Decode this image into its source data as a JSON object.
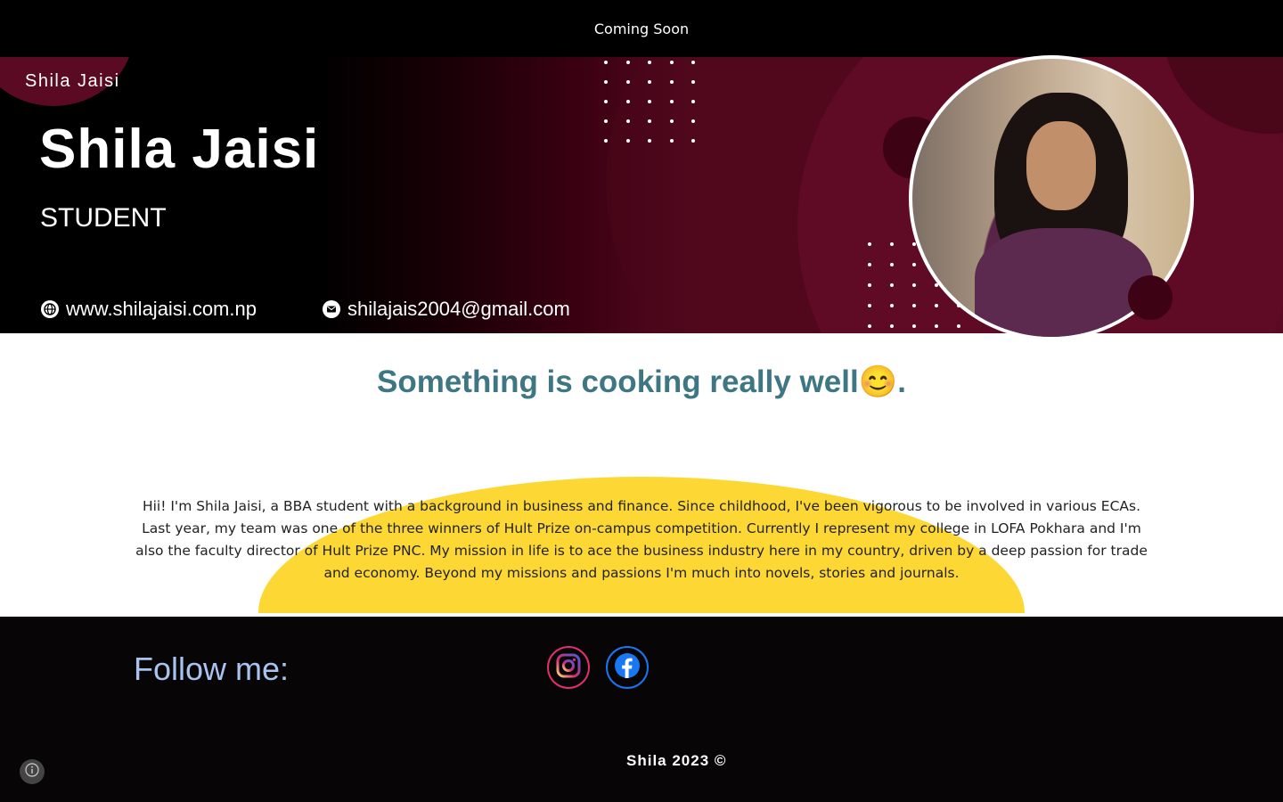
{
  "header": {
    "title": "Coming Soon"
  },
  "banner": {
    "site_name": "Shila Jaisi",
    "name": "Shila Jaisi",
    "role": "STUDENT",
    "website": "www.shilajaisi.com.np",
    "email": "shilajais2004@gmail.com"
  },
  "main": {
    "headline": "Something is cooking really well😊.",
    "bio": "Hii! I'm Shila Jaisi, a BBA student with a background in business and finance. Since childhood, I've been vigorous to be involved in various ECAs. Last year, my team was one of the three winners of Hult Prize on-campus competition. Currently I represent my college in LOFA Pokhara and I'm also the faculty director of Hult Prize PNC. My mission in life is to ace the business industry here in my country, driven by a deep passion for trade and economy. Beyond my missions and passions I'm much into novels, stories and journals."
  },
  "footer": {
    "follow_label": "Follow me:",
    "social": [
      {
        "icon": "instagram-icon",
        "color": "#e1306c"
      },
      {
        "icon": "facebook-icon",
        "color": "#1877f2"
      }
    ],
    "copyright": "Shila 2023 ©"
  },
  "colors": {
    "headline": "#3e7783",
    "accent_yellow": "#fdd835",
    "banner_maroon": "#5a0a22",
    "follow_text": "#a9c3ef"
  }
}
